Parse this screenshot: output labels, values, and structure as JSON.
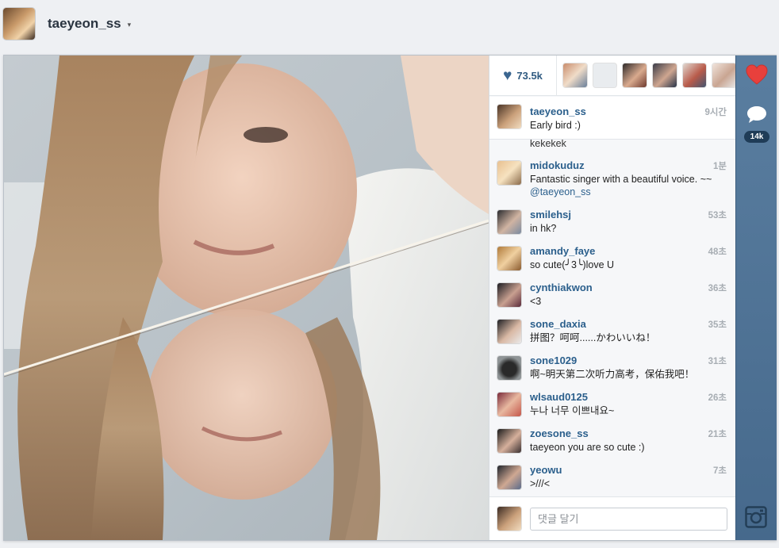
{
  "header": {
    "username": "taeyeon_ss",
    "caret": "▾"
  },
  "likes": {
    "count": "73.5k"
  },
  "caption": {
    "user": "taeyeon_ss",
    "time": "9시간",
    "text": "Early bird :)"
  },
  "comments": {
    "overflow_text": "kekekek",
    "items": [
      {
        "user": "midokuduz",
        "time": "1분",
        "text": "Fantastic singer with a beautiful voice. ~~ ",
        "mention": "@taeyeon_ss"
      },
      {
        "user": "smilehsj",
        "time": "53초",
        "text": "in hk?"
      },
      {
        "user": "amandy_faye",
        "time": "48초",
        "text": "so cute(╯3╰)love U"
      },
      {
        "user": "cynthiakwon",
        "time": "36초",
        "text": "<3"
      },
      {
        "user": "sone_daxia",
        "time": "35초",
        "text": "拼图？呵呵......かわいいね！"
      },
      {
        "user": "sone1029",
        "time": "31초",
        "text": "啊~明天第二次听力高考，保佑我吧！"
      },
      {
        "user": "wlsaud0125",
        "time": "26초",
        "text": "누나 너무 이쁘내요~"
      },
      {
        "user": "zoesone_ss",
        "time": "21초",
        "text": "taeyeon you are so cute :)"
      },
      {
        "user": "yeowu",
        "time": "7초",
        "text": ">///<"
      }
    ]
  },
  "comment_input": {
    "placeholder": "댓글 달기"
  },
  "rail": {
    "comment_count": "14k"
  },
  "colors": {
    "rail": "#4d7196",
    "username_link": "#2b5f8c",
    "like_heart": "#e8403c"
  }
}
